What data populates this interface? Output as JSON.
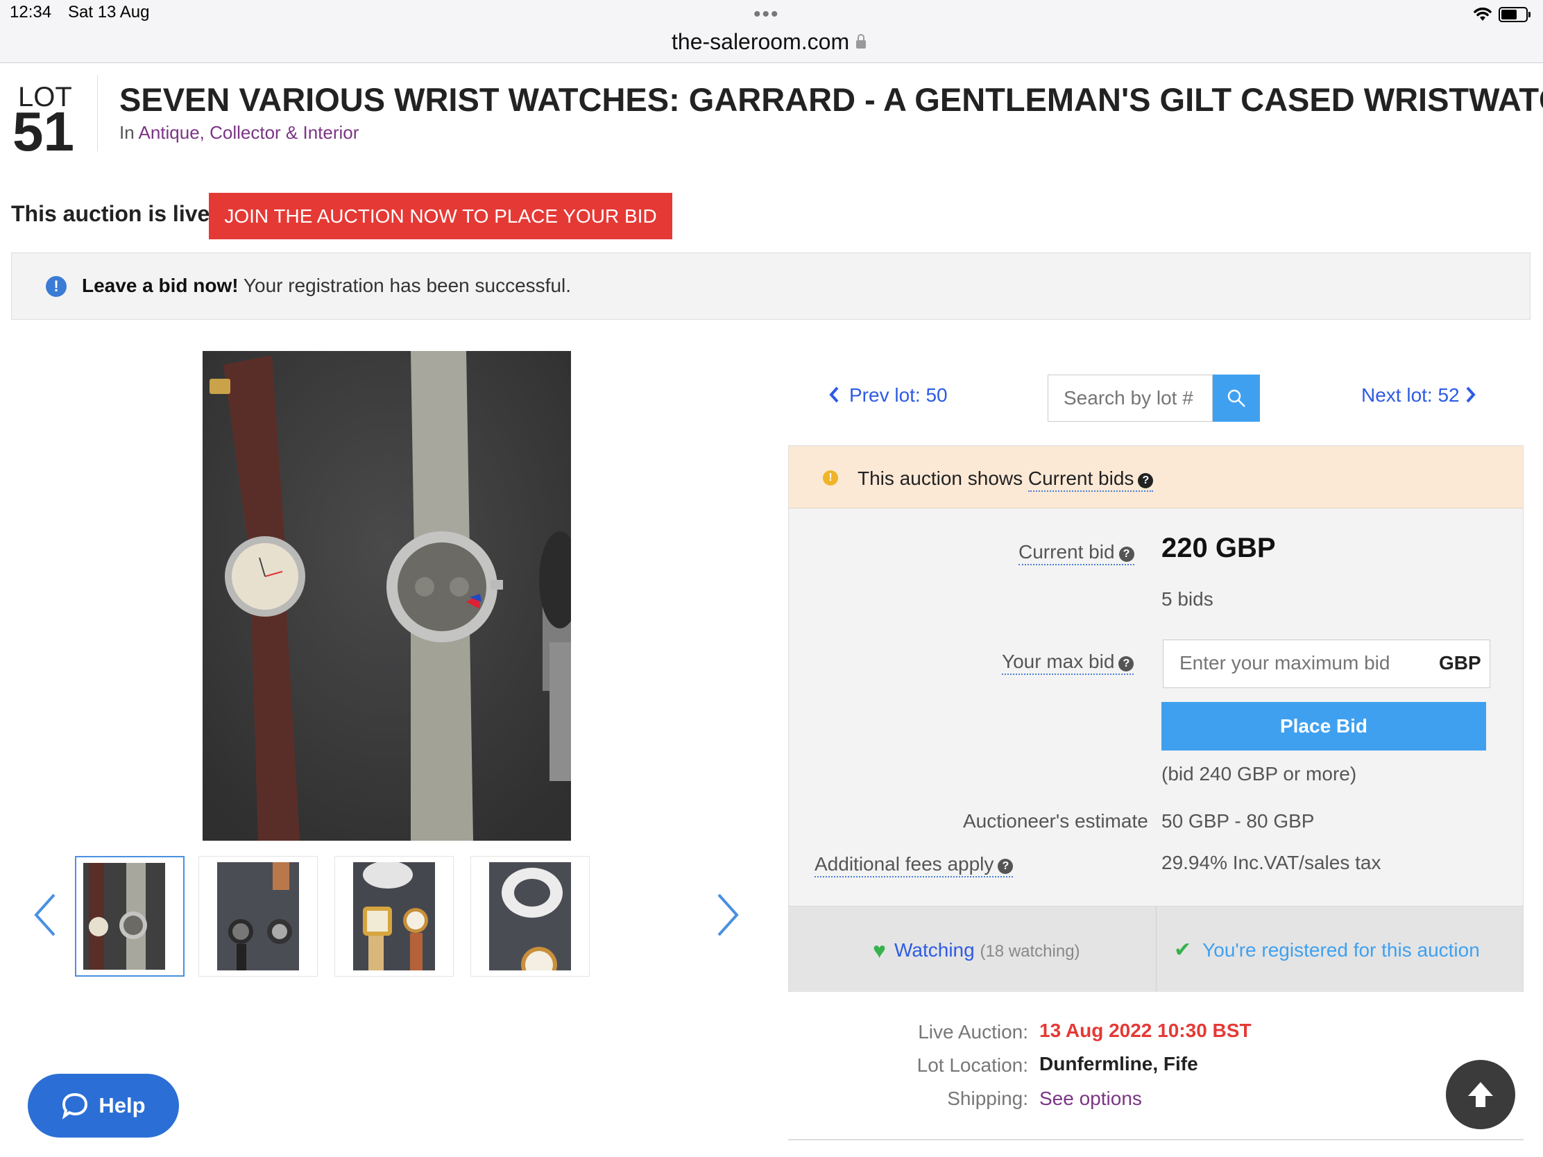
{
  "status_bar": {
    "time": "12:34",
    "date": "Sat 13 Aug",
    "dots": "•••",
    "url": "the-saleroom.com"
  },
  "lot": {
    "label": "LOT",
    "number": "51",
    "title": "SEVEN VARIOUS WRIST WATCHES: GARRARD - A GENTLEMAN'S GILT CASED WRISTWATCH,",
    "category_prefix": "In",
    "category": "Antique, Collector & Interior"
  },
  "live_banner": {
    "text": "This auction is live!",
    "button": "JOIN THE AUCTION NOW TO PLACE YOUR BID"
  },
  "info_bar": {
    "bold": "Leave a bid now!",
    "text": "Your registration has been successful."
  },
  "navigation": {
    "prev": "Prev lot: 50",
    "next": "Next lot: 52",
    "search_placeholder": "Search by lot #"
  },
  "bid_panel": {
    "notice": "This auction shows",
    "notice_link": "Current bids",
    "current_bid_label": "Current bid",
    "current_bid_value": "220 GBP",
    "bid_count": "5 bids",
    "max_bid_label": "Your max bid",
    "max_bid_placeholder": "Enter your maximum bid",
    "currency": "GBP",
    "place_bid": "Place Bid",
    "bid_hint": "(bid 240 GBP or more)",
    "estimate_label": "Auctioneer's estimate",
    "estimate_value": "50 GBP - 80 GBP",
    "fees_label": "Additional fees apply",
    "fees_value": "29.94% Inc.VAT/sales tax",
    "watching": "Watching",
    "watching_count": "(18 watching)",
    "registered": "You're registered for this auction"
  },
  "meta": {
    "live_label": "Live Auction:",
    "live_value": "13 Aug 2022 10:30 BST",
    "location_label": "Lot Location:",
    "location_value": "Dunfermline, Fife",
    "shipping_label": "Shipping:",
    "shipping_value": "See options"
  },
  "help": "Help",
  "colors": {
    "accent_red": "#e53935",
    "link_blue": "#2d5be3",
    "button_blue": "#3fa0f0",
    "category_purple": "#7b3585",
    "notice_bg": "#fbe9d6"
  },
  "icons": [
    "lock-icon",
    "wifi-icon",
    "battery-icon",
    "info-icon",
    "search-icon",
    "chevron-left-icon",
    "chevron-right-icon",
    "warning-icon",
    "help-circle-icon",
    "heart-icon",
    "check-icon",
    "chat-icon",
    "arrow-up-icon"
  ]
}
